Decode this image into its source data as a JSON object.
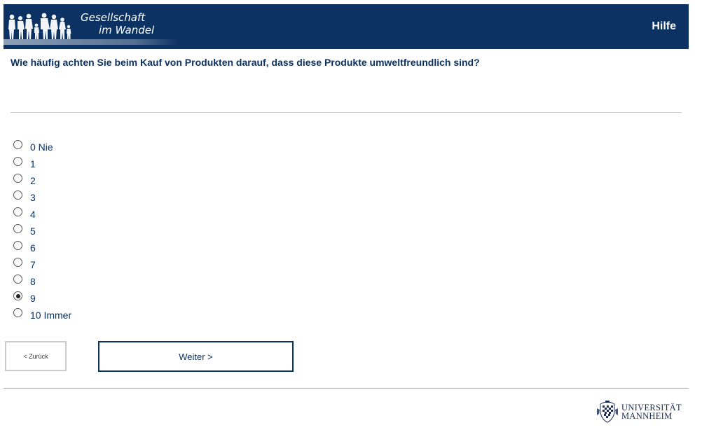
{
  "header": {
    "logo_line1": "Gesellschaft",
    "logo_line2": "im Wandel",
    "help_label": "Hilfe"
  },
  "question": {
    "text": "Wie häufig achten Sie beim Kauf von Produkten darauf, dass diese Produkte umweltfreundlich sind?"
  },
  "options": [
    {
      "label": "0 Nie",
      "checked": false
    },
    {
      "label": "1",
      "checked": false
    },
    {
      "label": "2",
      "checked": false
    },
    {
      "label": "3",
      "checked": false
    },
    {
      "label": "4",
      "checked": false
    },
    {
      "label": "5",
      "checked": false
    },
    {
      "label": "6",
      "checked": false
    },
    {
      "label": "7",
      "checked": false
    },
    {
      "label": "8",
      "checked": false
    },
    {
      "label": "9",
      "checked": true
    },
    {
      "label": "10 Immer",
      "checked": false
    }
  ],
  "nav": {
    "back_label": "< Zurück",
    "next_label": "Weiter >"
  },
  "footer": {
    "uni_line1": "UNIVERSITÄT",
    "uni_line2": "MANNHEIM"
  },
  "colors": {
    "brand_navy": "#0b3263",
    "divider": "#c8c8c8"
  },
  "icons": {
    "header_logo": "silhouette-people-icon",
    "university_crest": "mannheim-crest-icon"
  }
}
